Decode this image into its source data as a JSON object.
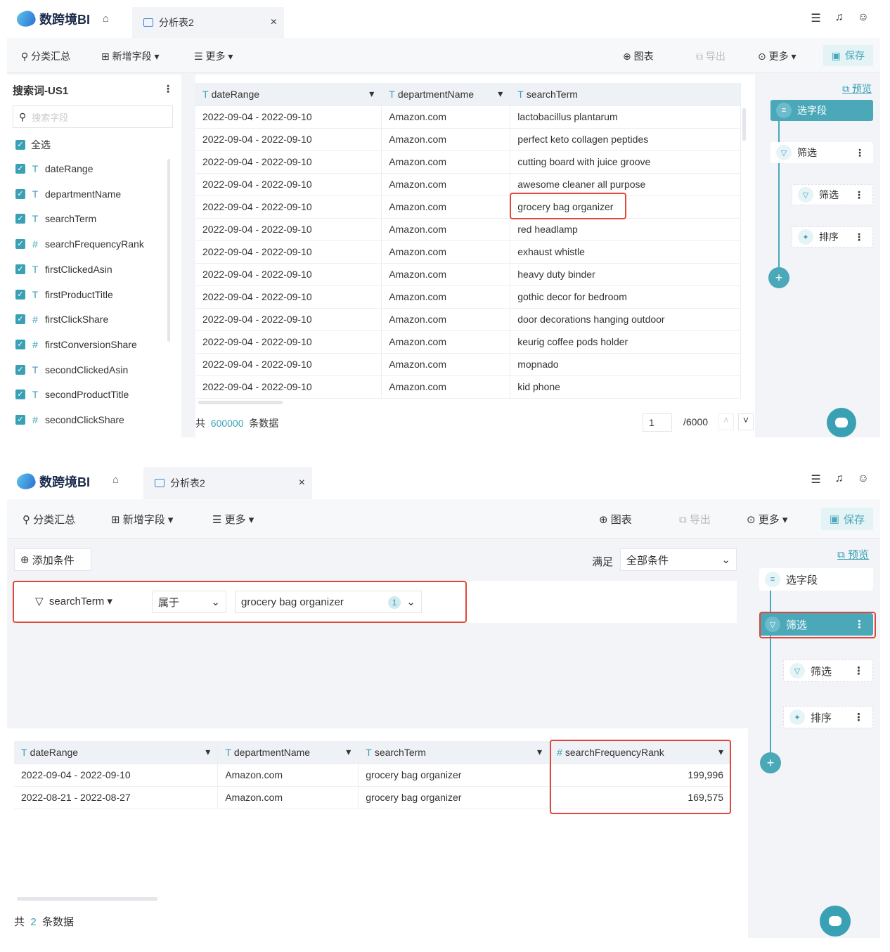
{
  "app": {
    "logo_text": "数跨境BI",
    "tab_label": "分析表2",
    "tab_close": "×",
    "home_icon": "⌂"
  },
  "toolbar": {
    "category_summary": "分类汇总",
    "add_field": "新增字段 ▾",
    "more_left": "更多 ▾",
    "chart": "图表",
    "export": "导出",
    "more_right": "更多 ▾",
    "save": "保存"
  },
  "flow": {
    "preview": "预览",
    "select_fields": "选字段",
    "filter_main": "筛选",
    "filter_sub": "筛选",
    "sort": "排序",
    "add": "+"
  },
  "top": {
    "sidebar": {
      "title": "搜索词-US1",
      "search_placeholder": "搜索字段",
      "select_all": "全选",
      "fields": [
        {
          "type": "T",
          "name": "dateRange"
        },
        {
          "type": "T",
          "name": "departmentName"
        },
        {
          "type": "T",
          "name": "searchTerm"
        },
        {
          "type": "#",
          "name": "searchFrequencyRank"
        },
        {
          "type": "T",
          "name": "firstClickedAsin"
        },
        {
          "type": "T",
          "name": "firstProductTitle"
        },
        {
          "type": "#",
          "name": "firstClickShare"
        },
        {
          "type": "#",
          "name": "firstConversionShare"
        },
        {
          "type": "T",
          "name": "secondClickedAsin"
        },
        {
          "type": "T",
          "name": "secondProductTitle"
        },
        {
          "type": "#",
          "name": "secondClickShare"
        }
      ]
    },
    "table": {
      "columns": [
        "dateRange",
        "departmentName",
        "searchTerm"
      ],
      "rows": [
        [
          "2022-09-04 - 2022-09-10",
          "Amazon.com",
          "lactobacillus plantarum"
        ],
        [
          "2022-09-04 - 2022-09-10",
          "Amazon.com",
          "perfect keto collagen peptides"
        ],
        [
          "2022-09-04 - 2022-09-10",
          "Amazon.com",
          "cutting board with juice groove"
        ],
        [
          "2022-09-04 - 2022-09-10",
          "Amazon.com",
          "awesome cleaner all purpose"
        ],
        [
          "2022-09-04 - 2022-09-10",
          "Amazon.com",
          "grocery bag organizer"
        ],
        [
          "2022-09-04 - 2022-09-10",
          "Amazon.com",
          "red headlamp"
        ],
        [
          "2022-09-04 - 2022-09-10",
          "Amazon.com",
          "exhaust whistle"
        ],
        [
          "2022-09-04 - 2022-09-10",
          "Amazon.com",
          "heavy duty binder"
        ],
        [
          "2022-09-04 - 2022-09-10",
          "Amazon.com",
          "gothic decor for bedroom"
        ],
        [
          "2022-09-04 - 2022-09-10",
          "Amazon.com",
          "door decorations hanging outdoor"
        ],
        [
          "2022-09-04 - 2022-09-10",
          "Amazon.com",
          "keurig coffee pods holder"
        ],
        [
          "2022-09-04 - 2022-09-10",
          "Amazon.com",
          "mopnado"
        ],
        [
          "2022-09-04 - 2022-09-10",
          "Amazon.com",
          "kid phone"
        ]
      ]
    },
    "footer": {
      "total_prefix": "共",
      "total_count": "600000",
      "total_suffix": "条数据",
      "page": "1",
      "page_total": "/6000"
    }
  },
  "bottom": {
    "add_condition": "添加条件",
    "match_label": "满足",
    "match_value": "全部条件",
    "condition": {
      "field": "searchTerm",
      "operator": "属于",
      "value": "grocery bag organizer",
      "count": "1"
    },
    "table": {
      "columns": [
        "dateRange",
        "departmentName",
        "searchTerm",
        "searchFrequencyRank"
      ],
      "rows": [
        [
          "2022-09-04 - 2022-09-10",
          "Amazon.com",
          "grocery bag organizer",
          "199,996"
        ],
        [
          "2022-08-21 - 2022-08-27",
          "Amazon.com",
          "grocery bag organizer",
          "169,575"
        ]
      ]
    },
    "footer": {
      "total_prefix": "共",
      "total_count": "2",
      "total_suffix": "条数据"
    }
  },
  "colors": {
    "accent": "#3aa1b5",
    "highlight": "#e0473a"
  }
}
